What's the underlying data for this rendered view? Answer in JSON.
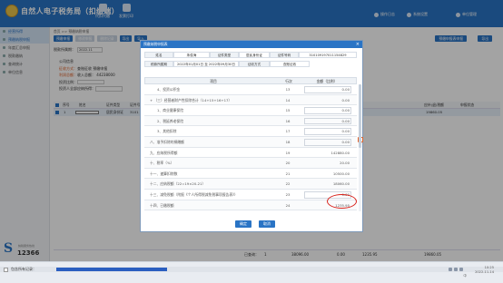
{
  "app": {
    "title": "自然人电子税务局（扣缴端）",
    "nav": [
      {
        "label": "代扣代缴",
        "icon": "people-icon"
      },
      {
        "label": "发票打印",
        "icon": "printer-icon"
      }
    ],
    "top_right": [
      {
        "label": "操作日志",
        "icon": "log-icon"
      },
      {
        "label": "系统设置",
        "icon": "gear-icon"
      },
      {
        "label": "单位管理",
        "icon": "building-icon"
      }
    ]
  },
  "sidebar": {
    "items": [
      {
        "label": "经营所得",
        "active": true
      },
      {
        "label": "预缴纳税申报",
        "active": true
      },
      {
        "label": "年度汇总申报",
        "active": false
      },
      {
        "label": "税款缴纳",
        "active": false
      },
      {
        "label": "查询统计",
        "active": false
      },
      {
        "label": "单位信息",
        "active": false
      }
    ],
    "logo": {
      "letter": "S",
      "number": "12366",
      "tagline": "纳税服务热线"
    }
  },
  "main": {
    "breadcrumb": "首页 >> 预缴纳税申报",
    "buttons": [
      "预缴申报",
      "修改申报",
      "删除记录",
      "导出",
      "导入"
    ],
    "right_buttons": [
      "预缴申报表申报",
      "导出"
    ],
    "period_label": "税款所属期：",
    "period_value": "2022.11",
    "info_title": "公司信息",
    "info_lines": [
      {
        "label": "征收方式：",
        "value": "查账征收",
        "extra": "预缴申报"
      },
      {
        "label": "利润总额：",
        "value": "收入总额：",
        "extra": "44238000"
      },
      {
        "label": "投资比例：",
        "value": "",
        "extra": ""
      },
      {
        "label": "投资人全部应纳所得：",
        "value": "",
        "extra": ""
      }
    ],
    "grid_headers": [
      "序号",
      "姓名",
      "证件类型",
      "证件号码",
      "",
      "应补(退)税额",
      "申报状态"
    ],
    "grid_row": {
      "index": "1",
      "name": "",
      "id_type": "居民身份证",
      "id_no": "3101",
      "tax": "19860.05",
      "status": ""
    },
    "summary": {
      "label": "已查询：",
      "count": "1",
      "v1": "38096.00",
      "v2": "0.00",
      "v3": "1235.95",
      "v4": "19860.05"
    }
  },
  "modal": {
    "title": "预缴纳税申报表",
    "info": [
      {
        "k": "姓名",
        "v": "朱俊海"
      },
      {
        "k": "证件类型",
        "v": "居民身份证"
      },
      {
        "k": "证件号码",
        "v": "310109197011154829"
      },
      {
        "k": "税款所属期",
        "v": "2022年01月01日 至 2022年09月30日"
      },
      {
        "k": "征收方式",
        "v": "查账征收"
      }
    ],
    "table_headers": {
      "item": "项目",
      "seq": "行次",
      "amount": "金额（比例）"
    },
    "rows": [
      {
        "name": "4、投资公积金",
        "seq": "13",
        "amount": "0.00"
      },
      {
        "name": "+ （三）经营者财产性扣除合计（14+15+16+17）",
        "seq": "14",
        "amount": "0.00"
      },
      {
        "name": "1、商业健康保险",
        "seq": "15",
        "amount": "0.00"
      },
      {
        "name": "2、税延养老保险",
        "seq": "16",
        "amount": "0.00"
      },
      {
        "name": "3、其他扣除",
        "seq": "17",
        "amount": "0.00"
      },
      {
        "name": "八、准予扣除的捐赠额",
        "seq": "18",
        "amount": "0.00"
      },
      {
        "name": "九、应纳税所得额",
        "seq": "19",
        "amount": "142880.00"
      },
      {
        "name": "十、税率（%）",
        "seq": "20",
        "amount": "20.00"
      },
      {
        "name": "十一、速算扣除数",
        "seq": "21",
        "amount": "10500.00"
      },
      {
        "name": "十二、应纳税额（22=19×20-21）",
        "seq": "22",
        "amount": "18060.00"
      },
      {
        "name": "十三、减免税额（附报《个人所得税减免税事项报告表》）",
        "seq": "23",
        "amount": "0.00"
      },
      {
        "name": "十四、已缴税额",
        "seq": "24",
        "amount": "1235.95"
      }
    ],
    "note_icon_text": "注",
    "buttons": {
      "confirm": "确定",
      "cancel": "取消"
    }
  },
  "taskbar": {
    "label": "包含所有记录：",
    "tray_time": "10:25",
    "tray_date": "2022-11-14",
    "ime": "中"
  },
  "colors": {
    "primary": "#2a74c5",
    "highlight": "#d9221b",
    "accent": "#e0622a"
  }
}
